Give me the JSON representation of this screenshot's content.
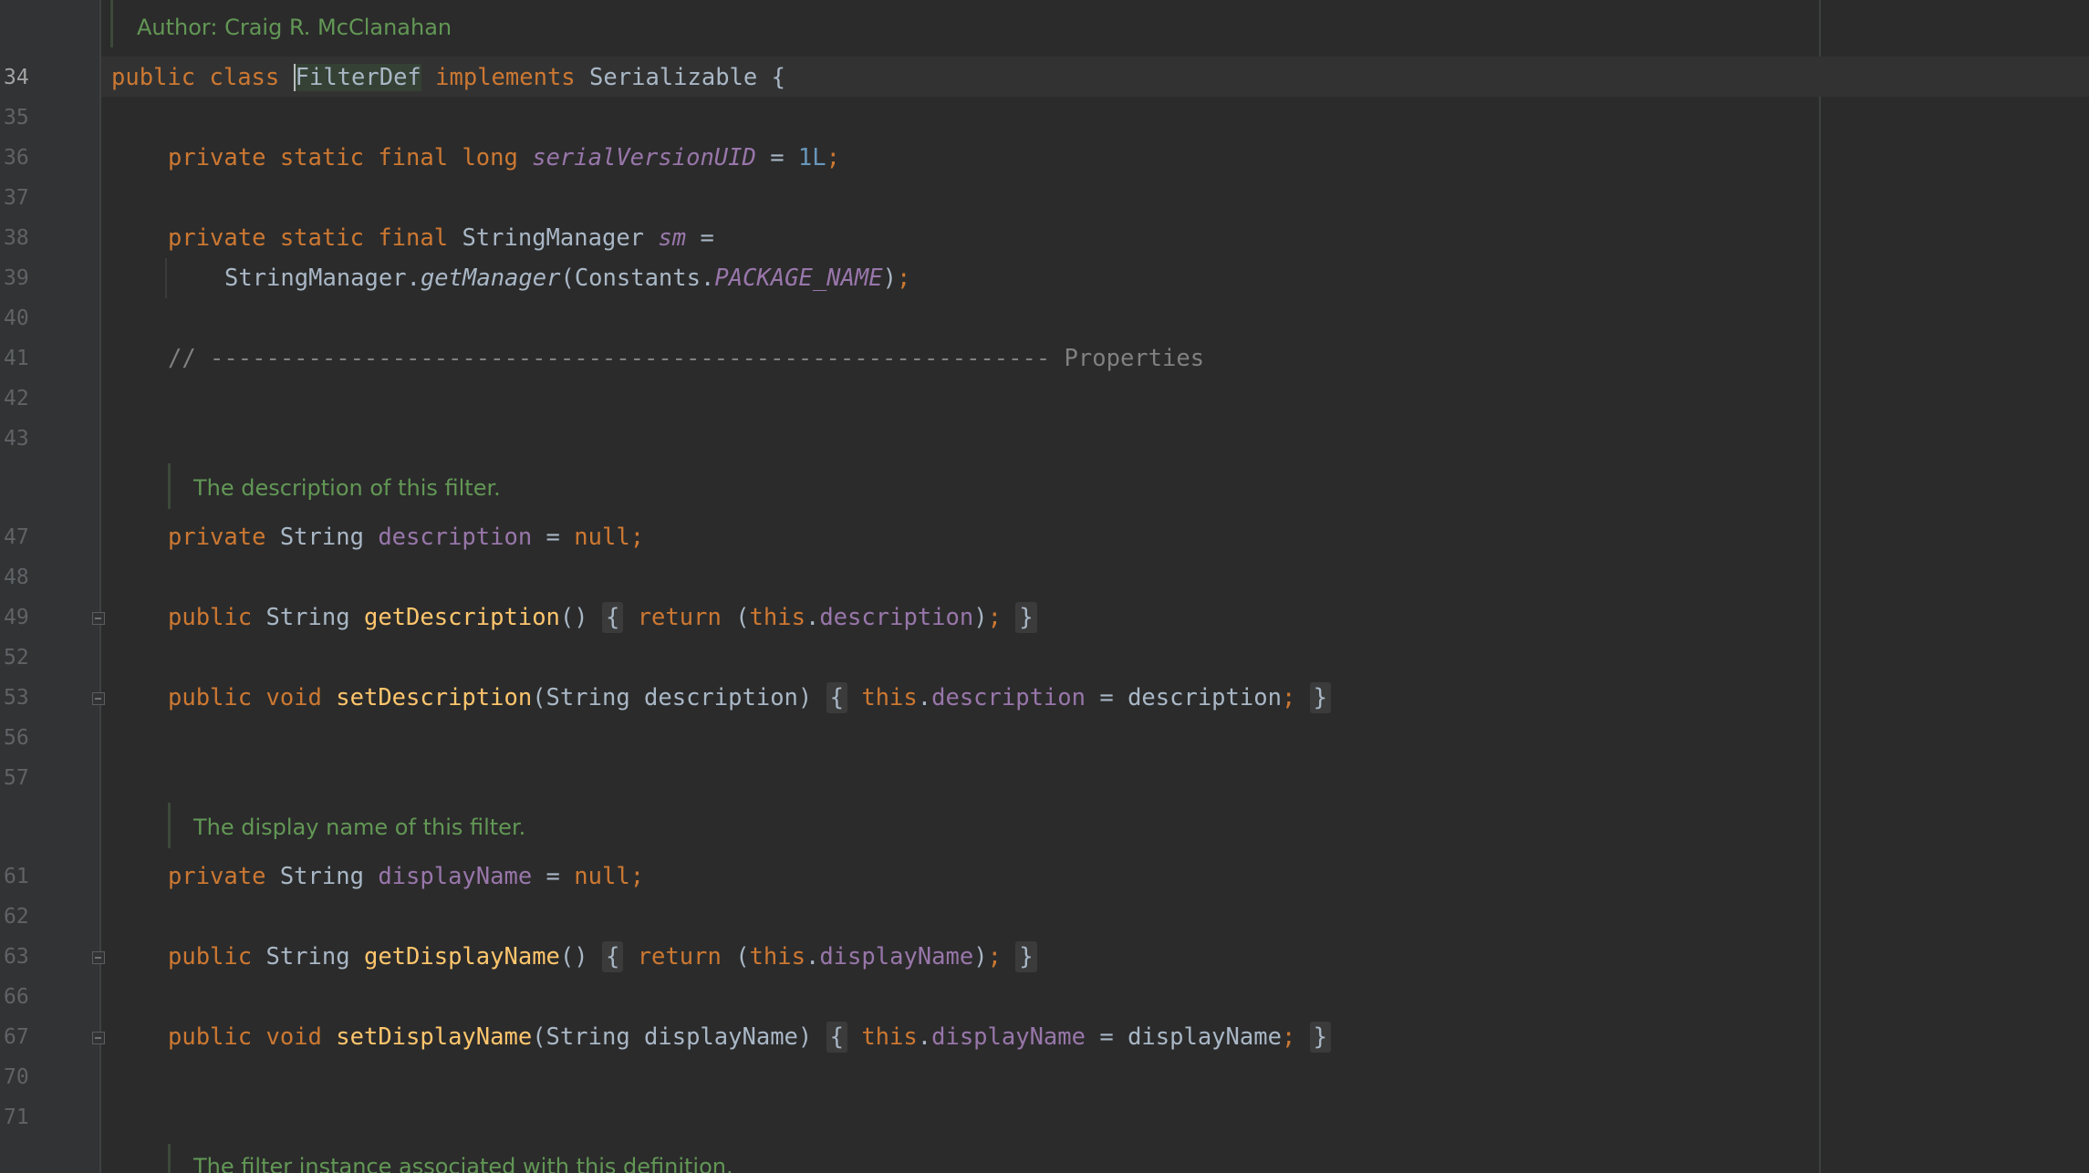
{
  "editor": {
    "doc_author": "Author: Craig R. McClanahan",
    "doc_description": "The description of this filter.",
    "doc_display_name": "The display name of this filter.",
    "doc_filter_instance": "The filter instance associated with this definition."
  },
  "line_numbers": {
    "l34": "34",
    "l35": "35",
    "l36": "36",
    "l37": "37",
    "l38": "38",
    "l39": "39",
    "l40": "40",
    "l41": "41",
    "l42": "42",
    "l43": "43",
    "l47": "47",
    "l48": "48",
    "l49": "49",
    "l52": "52",
    "l53": "53",
    "l56": "56",
    "l57": "57",
    "l61": "61",
    "l62": "62",
    "l63": "63",
    "l66": "66",
    "l67": "67",
    "l70": "70",
    "l71": "71"
  },
  "tokens": {
    "public": "public",
    "class": "class",
    "filterdef": "FilterDef",
    "implements": "implements",
    "serializable": "Serializable",
    "open_brace": " {",
    "private": "private",
    "static": "static",
    "final": "final",
    "long": "long",
    "serial_uid": "serialVersionUID",
    "eq": " = ",
    "one_l": "1L",
    "semi": ";",
    "string_manager": "StringManager",
    "sm": "sm",
    "eq_end": " =",
    "string_manager_dot": "StringManager.",
    "get_manager": "getManager",
    "constants_dot": "(Constants.",
    "package_name": "PACKAGE_NAME",
    "close_paren_semi": ");",
    "comment_props": "// ------------------------------------------------------------ Properties",
    "string": "String",
    "void": "void",
    "description": "description",
    "display_name": "displayName",
    "null": "null",
    "get_description": "getDescription",
    "set_description": "setDescription",
    "get_display_name": "getDisplayName",
    "set_display_name": "setDisplayName",
    "empty_parens": "()",
    "ph_open": "{",
    "ph_close": "}",
    "return": "return",
    "open_paren": "(",
    "close_paren": ")",
    "this": "this",
    "dot": ".",
    "param_description": "(String description)",
    "param_display_name": "(String displayName)",
    "desc_plain": "description",
    "display_plain": "displayName"
  }
}
